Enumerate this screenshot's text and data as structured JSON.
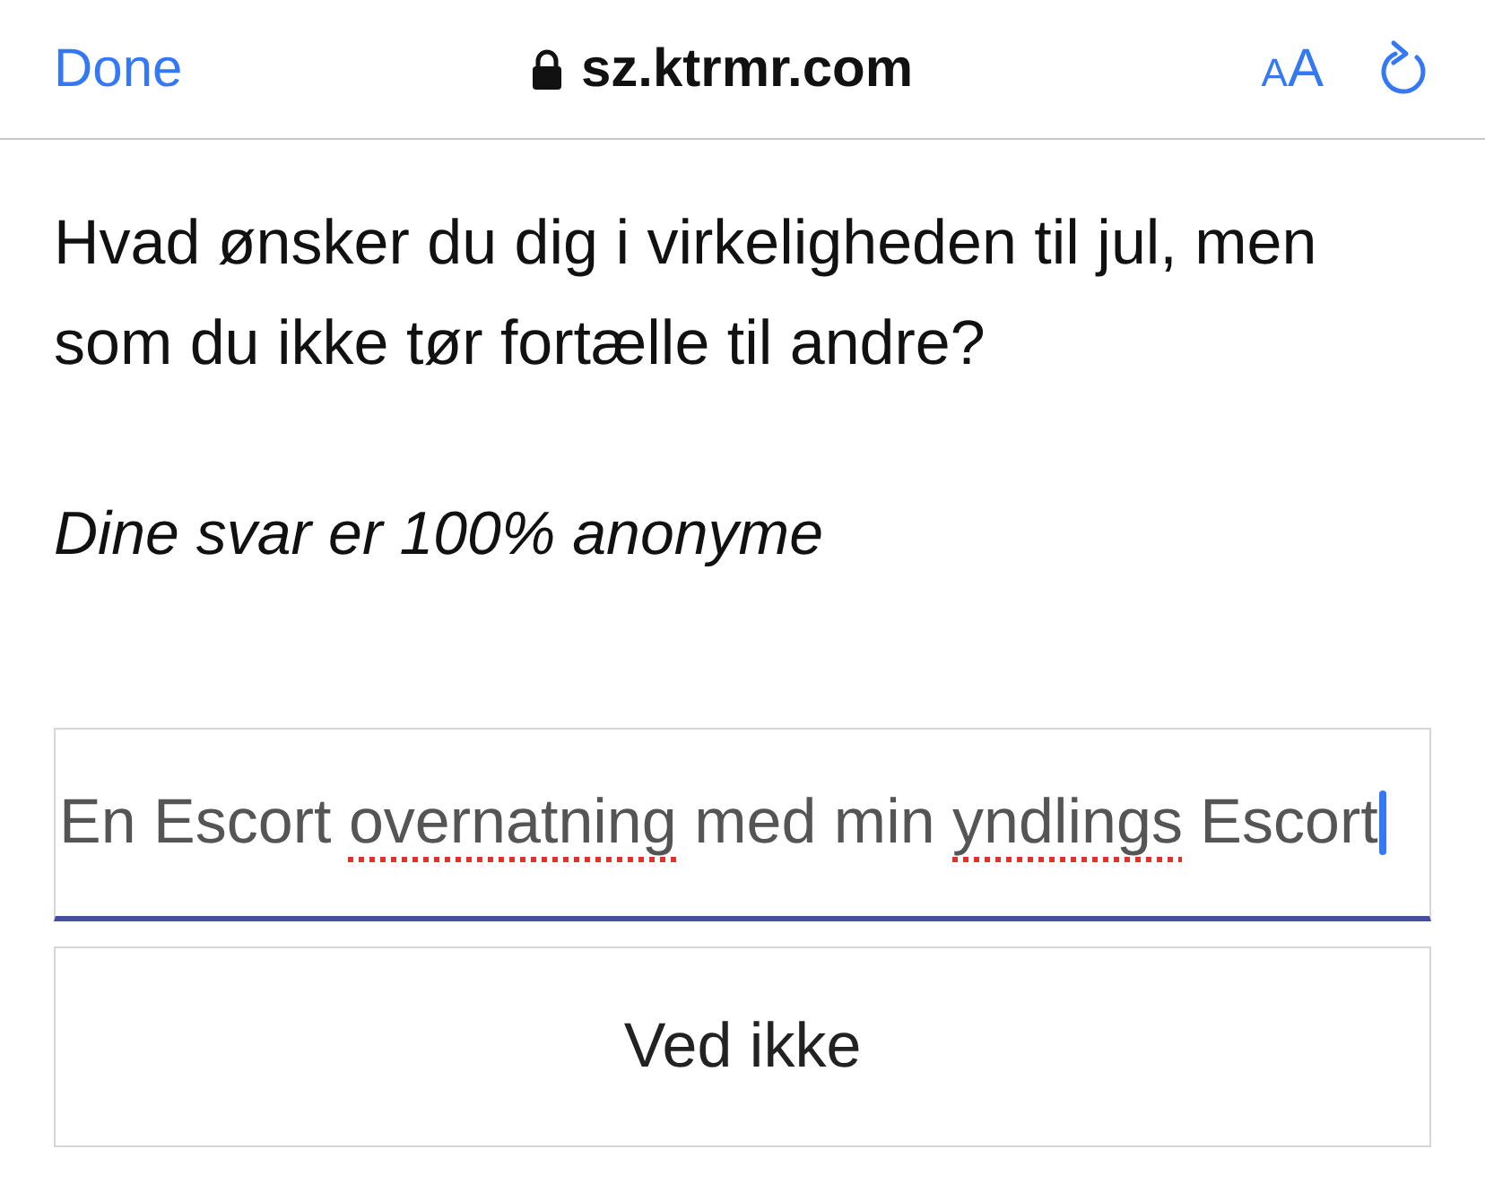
{
  "browser_bar": {
    "done": "Done",
    "url": "sz.ktrmr.com",
    "secure": true,
    "text_size": {
      "small": "A",
      "large": "A"
    }
  },
  "question": "Hvad ønsker du dig i virkeligheden til jul, men som du ikke tør fortælle til andre?",
  "note": "Dine svar er 100% anonyme",
  "answer": {
    "segments": [
      {
        "text": "En Escort ",
        "misspelled": false
      },
      {
        "text": "overnatning",
        "misspelled": true
      },
      {
        "text": " med min ",
        "misspelled": false
      },
      {
        "text": "yndlings",
        "misspelled": true
      },
      {
        "text": " Escort",
        "misspelled": false
      }
    ],
    "focused": true
  },
  "button": "Ved ikke"
}
